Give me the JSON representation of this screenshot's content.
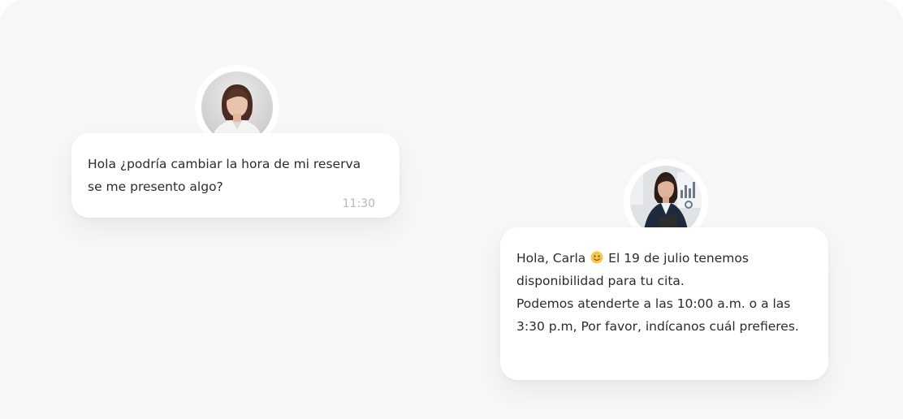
{
  "messages": [
    {
      "text_line1": "Hola ¿podría cambiar la hora de mi reserva",
      "text_line2": "se me presento algo?",
      "time": "11:30",
      "avatar_icon": "woman-avatar"
    },
    {
      "greeting": "Hola, Carla",
      "emoji_icon": "smiling-face-emoji",
      "after_emoji": "El 19 de julio tenemos",
      "line2": "disponibilidad para tu cita.",
      "line3": "Podemos atenderte a las 10:00 a.m. o a las",
      "line4": "3:30 p.m, Por favor, indícanos cuál prefieres.",
      "avatar_icon": "businesswoman-avatar"
    }
  ],
  "colors": {
    "background": "#f7f7f7",
    "bubble": "#ffffff",
    "text": "#2b2b2b",
    "time": "#b8b8b8"
  }
}
